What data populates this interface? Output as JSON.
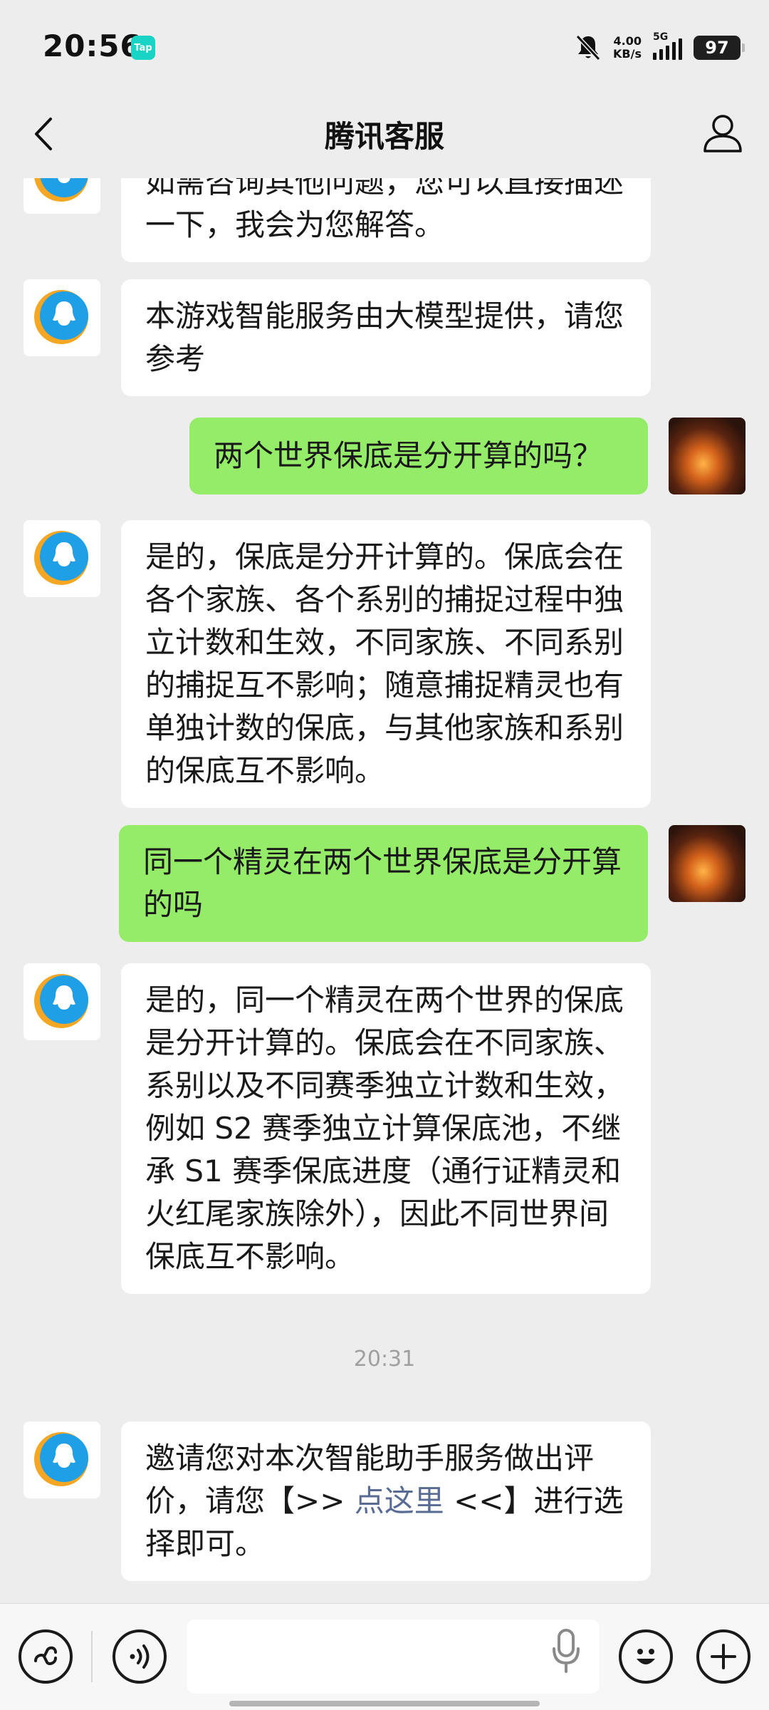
{
  "status_bar": {
    "time": "20:56",
    "app_badge": "Tap",
    "net_speed_value": "4.00",
    "net_speed_unit": "KB/s",
    "network": "5G",
    "battery": "97"
  },
  "header": {
    "title": "腾讯客服"
  },
  "messages": [
    {
      "sender": "bot",
      "text": "如需咨询其他问题，您可以直接描述一下，我会为您解答。"
    },
    {
      "sender": "bot",
      "text": "本游戏智能服务由大模型提供，请您参考"
    },
    {
      "sender": "user",
      "text": "两个世界保底是分开算的吗？"
    },
    {
      "sender": "bot",
      "text": "是的，保底是分开计算的。保底会在各个家族、各个系别的捕捉过程中独立计数和生效，不同家族、不同系别的捕捉互不影响；随意捕捉精灵也有单独计数的保底，与其他家族和系别的保底互不影响。"
    },
    {
      "sender": "user",
      "text": "同一个精灵在两个世界保底是分开算的吗"
    },
    {
      "sender": "bot",
      "text": "是的，同一个精灵在两个世界的保底是分开计算的。保底会在不同家族、系别以及不同赛季独立计数和生效，例如 S2 赛季独立计算保底池，不继承 S1 赛季保底进度（通行证精灵和火红尾家族除外），因此不同世界间保底互不影响。"
    }
  ],
  "timestamp": "20:31",
  "rating_message": {
    "before": "邀请您对本次智能助手服务做出评价，请您【>> ",
    "link": "点这里",
    "after": " <<】进行选择即可。"
  },
  "colors": {
    "background": "#ededed",
    "bot_bubble": "#ffffff",
    "user_bubble": "#95ec69",
    "link": "#576b95"
  }
}
